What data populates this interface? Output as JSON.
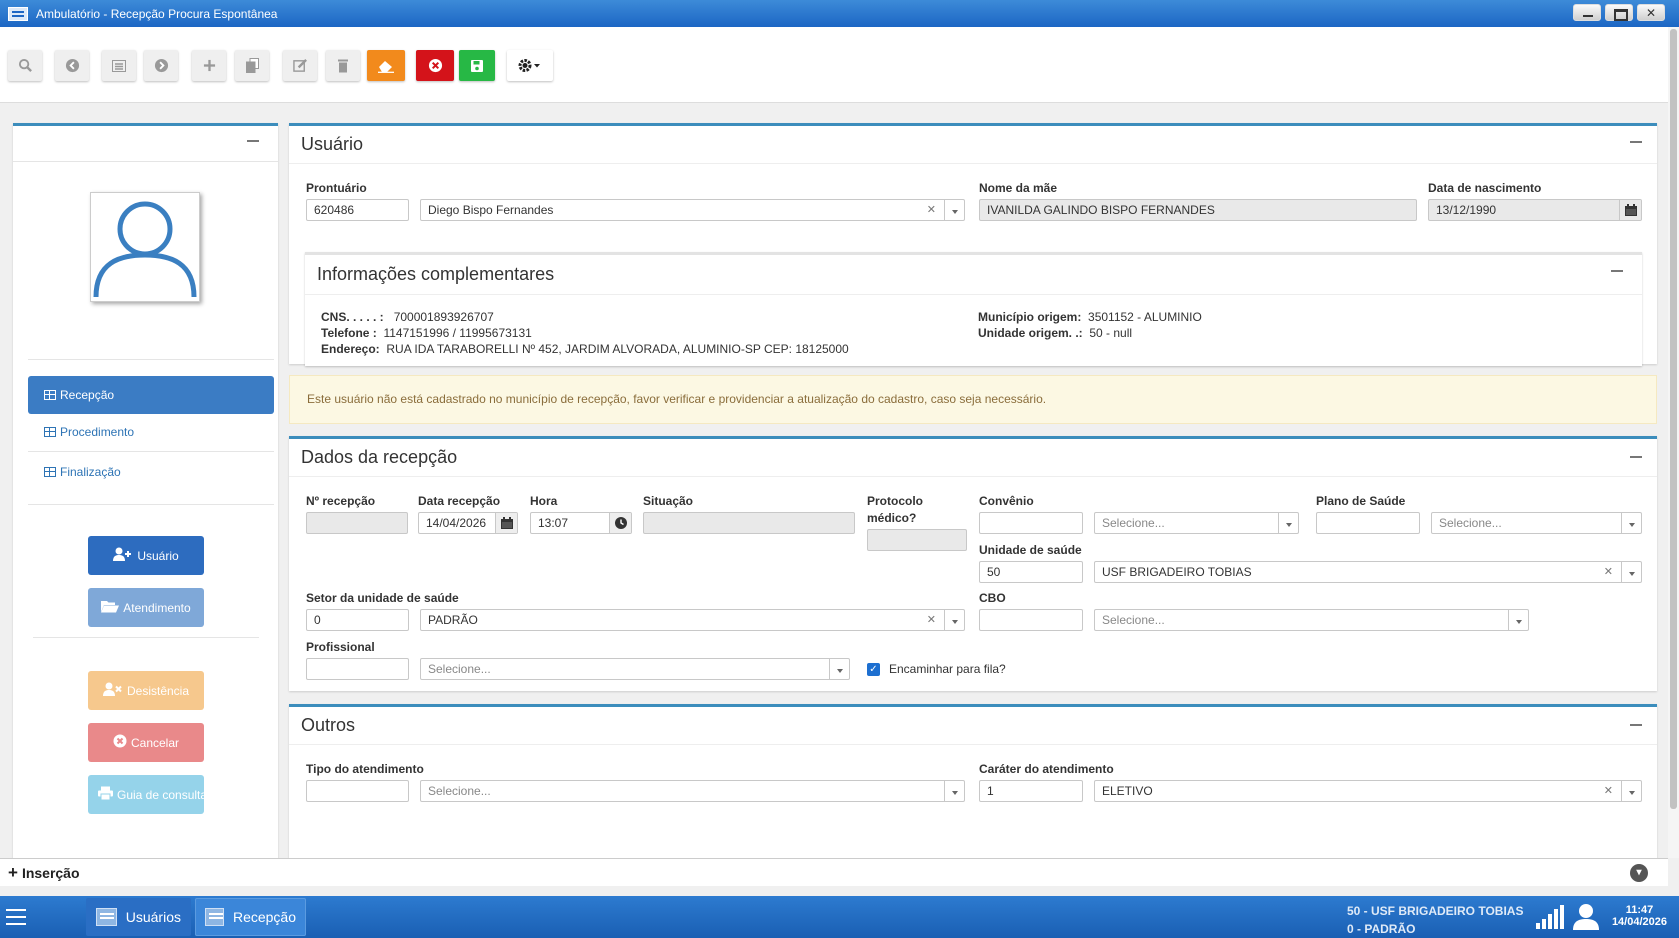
{
  "window": {
    "title": "Ambulatório - Recepção Procura Espontânea"
  },
  "toolbar": {
    "buttons": [
      "search-icon",
      "arrow-left-icon",
      "list-icon",
      "arrow-right-icon",
      "plus-icon",
      "copy-icon",
      "edit-icon",
      "trash-icon",
      "eraser-icon",
      "cancel-icon",
      "save-icon",
      "gear-icon"
    ]
  },
  "sidebar": {
    "nav": [
      {
        "label": "Recepção",
        "active": true
      },
      {
        "label": "Procedimento",
        "active": false
      },
      {
        "label": "Finalização",
        "active": false
      }
    ],
    "buttons": {
      "usuario": "Usuário",
      "atendimento": "Atendimento",
      "desistencia": "Desistência",
      "cancelar": "Cancelar",
      "guia": "Guia de consulta"
    }
  },
  "usuario": {
    "title": "Usuário",
    "prontuario_label": "Prontuário",
    "prontuario": "620486",
    "nome": "Diego Bispo Fernandes",
    "mae_label": "Nome da mãe",
    "mae": "IVANILDA GALINDO BISPO FERNANDES",
    "nascimento_label": "Data de nascimento",
    "nascimento": "13/12/1990",
    "info": {
      "title": "Informações complementares",
      "cns_label": "CNS. . . . . :",
      "cns": "700001893926707",
      "telefone_label": "Telefone :",
      "telefone": "1147151996 / 11995673131",
      "endereco_label": "Endereço:",
      "endereco": "RUA IDA TARABORELLI Nº 452, JARDIM ALVORADA, ALUMINIO-SP CEP: 18125000",
      "municipio_label": "Município origem:",
      "municipio": "3501152 - ALUMINIO",
      "unidade_label": "Unidade origem. .:",
      "unidade": "50 - null"
    }
  },
  "alert": "Este usuário não está cadastrado no município de recepção, favor verificar e providenciar a atualização do cadastro, caso seja necessário.",
  "recepcao": {
    "title": "Dados da recepção",
    "n_label": "Nº recepção",
    "data_label": "Data recepção",
    "data": "14/04/2026",
    "hora_label": "Hora",
    "hora": "13:07",
    "situacao_label": "Situação",
    "protocolo_label1": "Protocolo",
    "protocolo_label2": "médico?",
    "convenio_label": "Convênio",
    "convenio_ph": "Selecione...",
    "plano_label": "Plano de Saúde",
    "plano_ph": "Selecione...",
    "unidade_label": "Unidade de saúde",
    "unidade_code": "50",
    "unidade": "USF BRIGADEIRO TOBIAS",
    "setor_label": "Setor da unidade de saúde",
    "setor_code": "0",
    "setor": "PADRÃO",
    "cbo_label": "CBO",
    "cbo_ph": "Selecione...",
    "profissional_label": "Profissional",
    "profissional_ph": "Selecione...",
    "encaminhar": "Encaminhar para fila?"
  },
  "outros": {
    "title": "Outros",
    "tipo_label": "Tipo do atendimento",
    "tipo_ph": "Selecione...",
    "carater_label": "Caráter do atendimento",
    "carater_code": "1",
    "carater": "ELETIVO"
  },
  "insercao": "Inserção",
  "taskbar": {
    "tasks": [
      "Usuários",
      "Recepção"
    ],
    "unit": "50 - USF BRIGADEIRO TOBIAS",
    "sector": "0 - PADRÃO",
    "time": "11:47",
    "date": "14/04/2026"
  },
  "colors": {
    "primary": "#3c8dbc",
    "nav_active": "#3b7cc4",
    "orange": "#f28a1c",
    "red": "#d4131a",
    "green": "#27b845"
  }
}
